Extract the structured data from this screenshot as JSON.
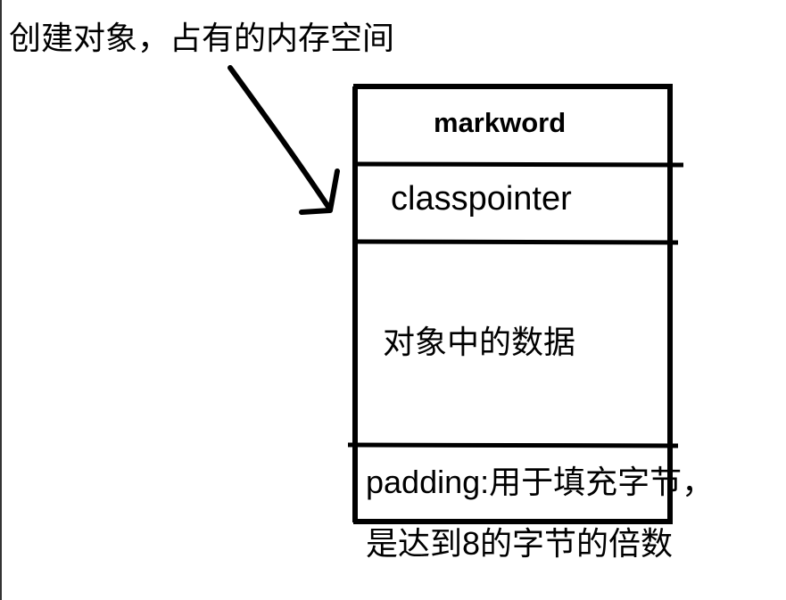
{
  "title": "创建对象，占有的内存空间",
  "object_layout": {
    "sections": [
      {
        "key": "markword",
        "label": "markword"
      },
      {
        "key": "classpointer",
        "label": "classpointer"
      },
      {
        "key": "data",
        "label": "对象中的数据"
      },
      {
        "key": "padding",
        "label_line1": "padding:用于填充字节，",
        "label_line2": "是达到8的字节的倍数"
      }
    ]
  },
  "colors": {
    "ink": "#000000",
    "background": "#ffffff"
  }
}
